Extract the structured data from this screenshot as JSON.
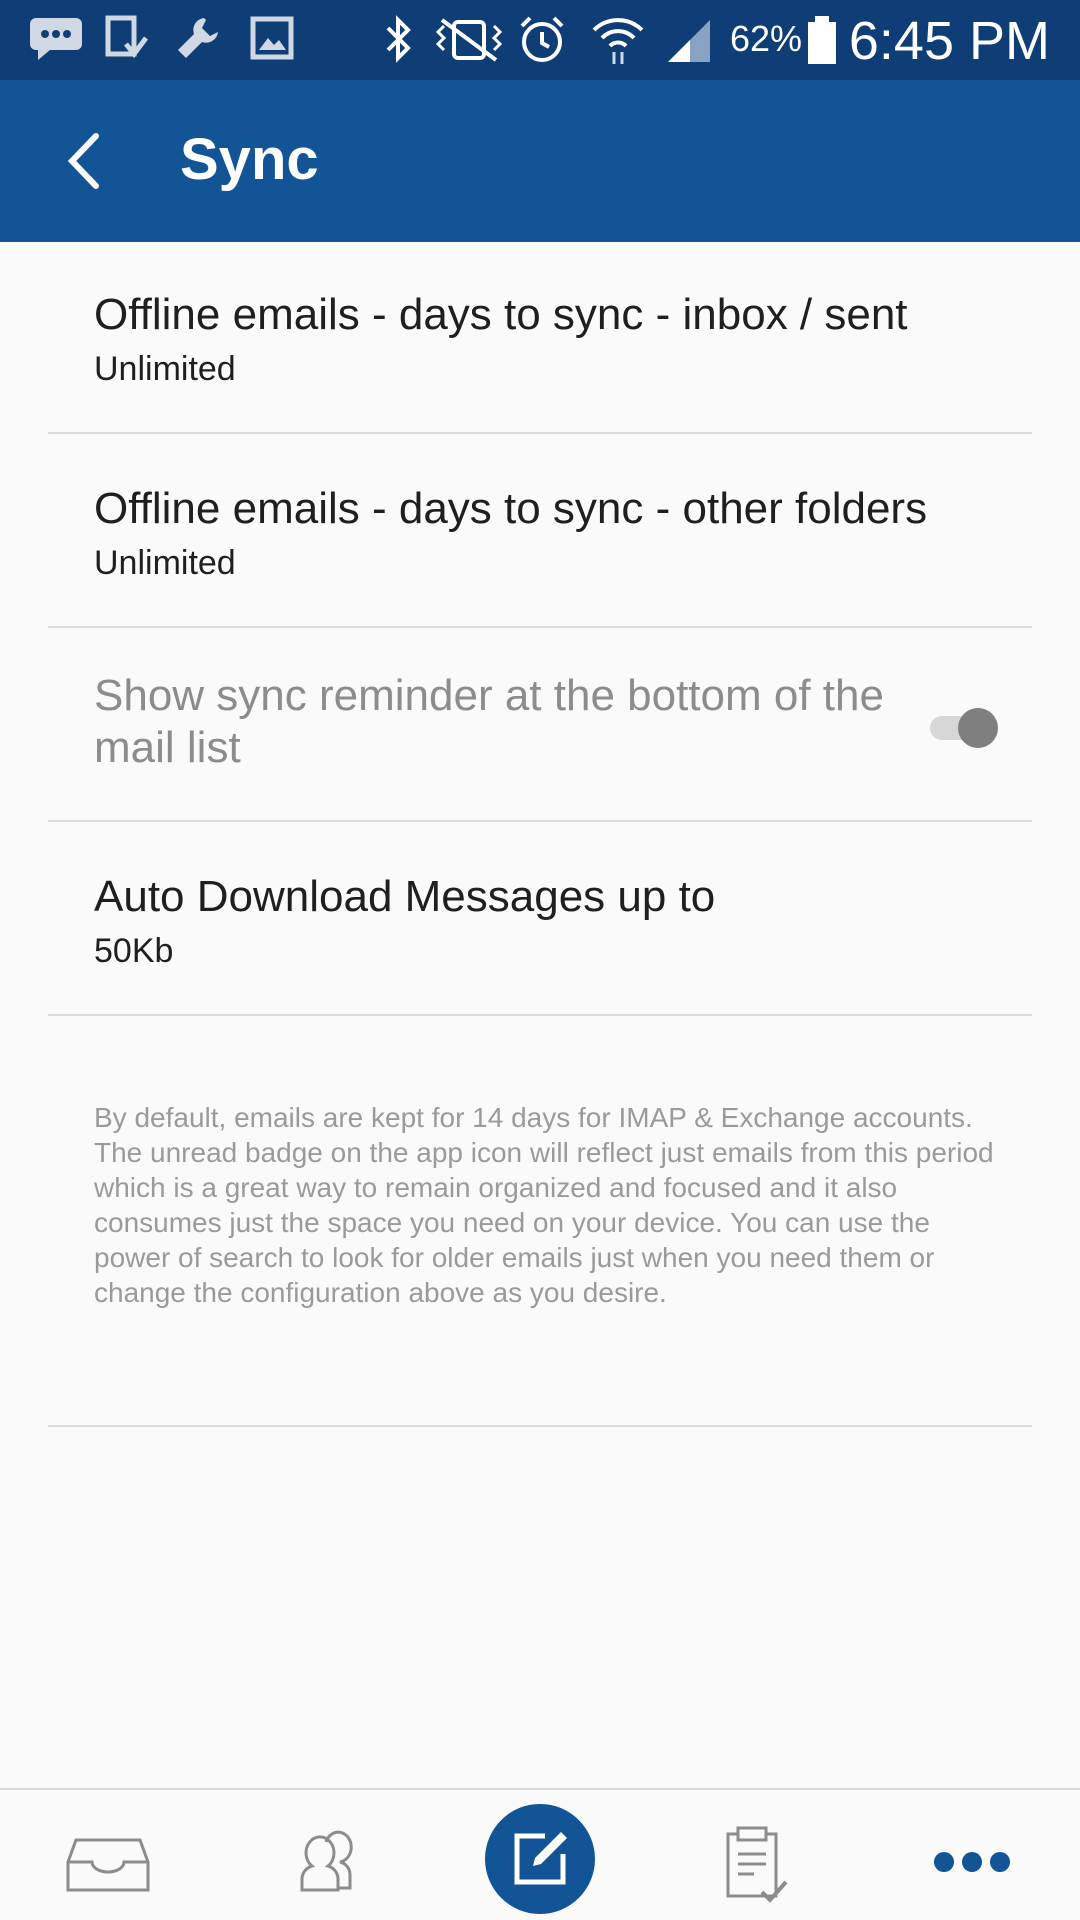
{
  "status_bar": {
    "battery_percent": "62%",
    "time": "6:45 PM"
  },
  "app_bar": {
    "title": "Sync"
  },
  "settings": [
    {
      "title": "Offline emails - days to sync - inbox / sent",
      "value": "Unlimited"
    },
    {
      "title": "Offline emails - days to sync - other folders",
      "value": "Unlimited"
    },
    {
      "title": "Show sync reminder at the bottom of the mail list",
      "enabled": false,
      "toggle_on": true
    },
    {
      "title": "Auto Download Messages up to",
      "value": "50Kb"
    }
  ],
  "info_text": "By default, emails are kept for 14 days for IMAP & Exchange accounts. The unread badge on the app icon will reflect just emails from this period which is a great way to remain organized and focused and it also consumes just the space you need on your device. You can use the power of search to look for older emails just when you need them or change the configuration above as you desire.",
  "bottom_nav": [
    {
      "icon": "inbox-icon"
    },
    {
      "icon": "contacts-icon"
    },
    {
      "icon": "compose-icon"
    },
    {
      "icon": "clipboard-check-icon"
    },
    {
      "icon": "more-icon"
    }
  ],
  "colors": {
    "status_bar": "#0e3e75",
    "app_bar": "#125496",
    "compose_button": "#125496",
    "disabled_text": "#8c8c8c"
  }
}
